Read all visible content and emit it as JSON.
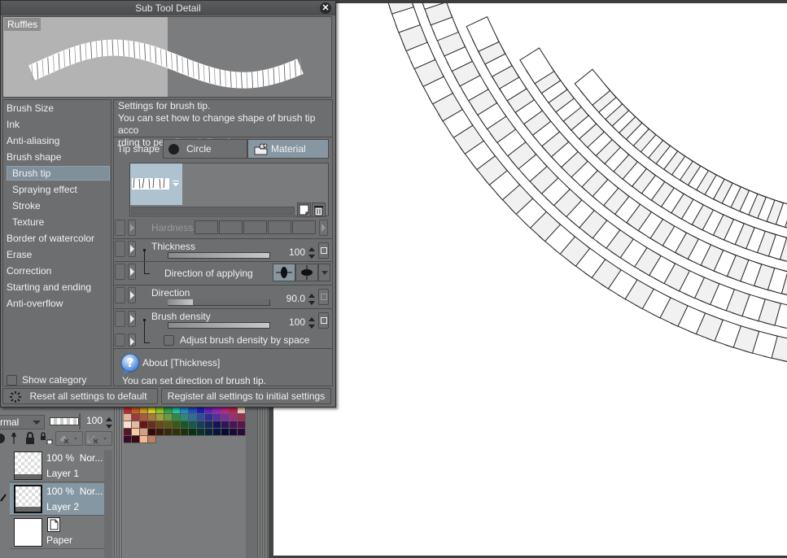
{
  "window": {
    "title": "Sub Tool Detail",
    "close_icon": "close-icon"
  },
  "preview": {
    "tool_name": "Ruffles"
  },
  "categories": [
    {
      "label": "Brush Size",
      "level": 0,
      "selected": false
    },
    {
      "label": "Ink",
      "level": 0,
      "selected": false
    },
    {
      "label": "Anti-aliasing",
      "level": 0,
      "selected": false
    },
    {
      "label": "Brush shape",
      "level": 0,
      "selected": false
    },
    {
      "label": "Brush tip",
      "level": 1,
      "selected": true
    },
    {
      "label": "Spraying effect",
      "level": 1,
      "selected": false
    },
    {
      "label": "Stroke",
      "level": 1,
      "selected": false
    },
    {
      "label": "Texture",
      "level": 1,
      "selected": false
    },
    {
      "label": "Border of watercolor",
      "level": 0,
      "selected": false
    },
    {
      "label": "Erase",
      "level": 0,
      "selected": false
    },
    {
      "label": "Correction",
      "level": 0,
      "selected": false
    },
    {
      "label": "Starting and ending",
      "level": 0,
      "selected": false
    },
    {
      "label": "Anti-overflow",
      "level": 0,
      "selected": false
    }
  ],
  "show_category": {
    "label": "Show category",
    "checked": false
  },
  "settings": {
    "description_line1": "Settings for brush tip.",
    "description_line2": "You can set how to change shape of brush tip acco",
    "description_line3": "rding to pen tilt and direction.",
    "tip_shape": {
      "label": "Tip shape",
      "options": [
        "Circle",
        "Material"
      ],
      "selected": "Material"
    },
    "hardness": {
      "label": "Hardness",
      "enabled": false
    },
    "thickness": {
      "label": "Thickness",
      "value": "100",
      "fraction": 1.0
    },
    "direction_of_applying": {
      "label": "Direction of applying",
      "selected_index": 0
    },
    "direction": {
      "label": "Direction",
      "value": "90.0",
      "fraction": 0.25
    },
    "brush_density": {
      "label": "Brush density",
      "value": "100",
      "fraction": 1.0
    },
    "adjust_density": {
      "label": "Adjust brush density by space",
      "checked": false
    }
  },
  "about": {
    "title": "About [Thickness]",
    "text": "You can set direction of brush tip."
  },
  "buttons": {
    "reset": "Reset all settings to default",
    "register": "Register all settings to initial settings"
  },
  "layer_panel": {
    "blend_mode": "rmal",
    "opacity": "100",
    "layers": [
      {
        "opacity": "100 %",
        "blend": "Nor...",
        "name": "Layer 1",
        "selected": false
      },
      {
        "opacity": "100 %",
        "blend": "Nor...",
        "name": "Layer 2",
        "selected": true
      },
      {
        "opacity": "",
        "blend": "",
        "name": "Paper",
        "selected": false
      }
    ]
  },
  "color_palette": {
    "rows": [
      [
        "#c42a2a",
        "#d35a1e",
        "#d49a1e",
        "#d6d01e",
        "#8fcd1e",
        "#2aa84a",
        "#1ec8a0",
        "#1e8cd4",
        "#1e50c8",
        "#1e1ec8",
        "#6a1ec8",
        "#a01ec8",
        "#c81e8c",
        "#c81e50",
        "#f0c8b4",
        "#e6b49a"
      ],
      [
        "#9e3a3a",
        "#a85a3a",
        "#a87a3a",
        "#a0a03a",
        "#6e9a3a",
        "#2e8a46",
        "#2e8a78",
        "#2e6e9a",
        "#2e4e9a",
        "#2e2e9a",
        "#5a2e9a",
        "#7a2e9a",
        "#9a2e7a",
        "#9a2e50",
        "#fde0cc",
        "#e8b89c"
      ],
      [
        "#6a1414",
        "#6a3014",
        "#6a4a14",
        "#5a5a14",
        "#3a5a14",
        "#145a28",
        "#145a4a",
        "#143e5a",
        "#14285a",
        "#14145a",
        "#32145a",
        "#4a145a",
        "#5a144a",
        "#5a1428",
        "#fcc8a4",
        "#d8a080"
      ],
      [
        "#3a0a0a",
        "#3a1a0a",
        "#3a2a0a",
        "#323208",
        "#1e3208",
        "#083214",
        "#08322a",
        "#08223a",
        "#08143a",
        "#080a3a",
        "#1a0a3a",
        "#2a0a3a",
        "#3a0a2a",
        "#3a0a14",
        "#f8b890",
        "#c08060"
      ]
    ]
  }
}
